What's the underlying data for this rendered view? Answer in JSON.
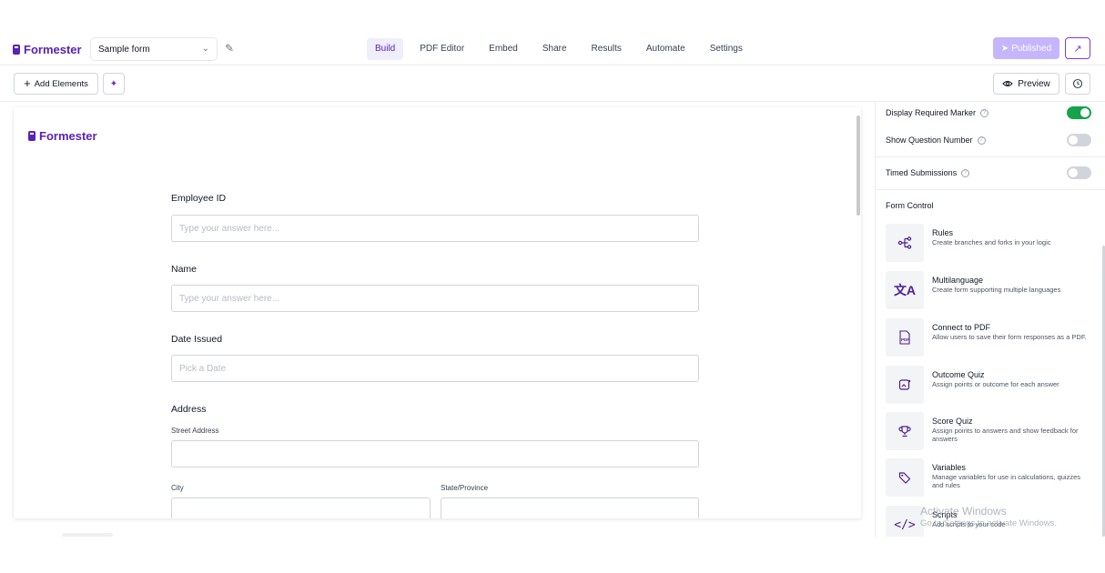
{
  "header": {
    "brand": "Formester",
    "form_name": "Sample form",
    "tabs": [
      {
        "label": "Build",
        "active": true
      },
      {
        "label": "PDF Editor"
      },
      {
        "label": "Embed"
      },
      {
        "label": "Share"
      },
      {
        "label": "Results"
      },
      {
        "label": "Automate"
      },
      {
        "label": "Settings"
      }
    ],
    "published_label": "Published",
    "accent": "#5b21b6"
  },
  "toolbar": {
    "add_elements": "Add Elements",
    "preview": "Preview"
  },
  "canvas": {
    "brand": "Formester",
    "fields": {
      "employee_id": {
        "label": "Employee ID",
        "placeholder": "Type your answer here..."
      },
      "name": {
        "label": "Name",
        "placeholder": "Type your answer here..."
      },
      "date_issued": {
        "label": "Date Issued",
        "placeholder": "Pick a Date"
      },
      "address": {
        "label": "Address",
        "street": "Street Address",
        "city": "City",
        "state": "State/Province"
      }
    }
  },
  "panel": {
    "settings": [
      {
        "label": "Display Required Marker",
        "on": true
      },
      {
        "label": "Show Question Number",
        "on": false
      },
      {
        "label": "Timed Submissions",
        "on": false
      }
    ],
    "form_control_title": "Form Control",
    "controls": [
      {
        "icon": "rules-icon",
        "title": "Rules",
        "desc": "Create branches and forks in your logic"
      },
      {
        "icon": "translate-icon",
        "title": "Multilanguage",
        "desc": "Create form supporting multiple languages"
      },
      {
        "icon": "pdf-icon",
        "title": "Connect to PDF",
        "desc": "Allow users to save their form responses as a PDF."
      },
      {
        "icon": "quiz-icon",
        "title": "Outcome Quiz",
        "desc": "Assign points or outcome for each answer"
      },
      {
        "icon": "trophy-icon",
        "title": "Score Quiz",
        "desc": "Assign points to answers and show feedback for answers"
      },
      {
        "icon": "tag-icon",
        "title": "Variables",
        "desc": "Manage variables for use in calculations, quizzes and rules"
      },
      {
        "icon": "code-icon",
        "title": "Scripts",
        "desc": "Add scripts to your code"
      }
    ]
  },
  "watermark": {
    "line1": "Activate Windows",
    "line2": "Go to Settings to activate Windows."
  }
}
